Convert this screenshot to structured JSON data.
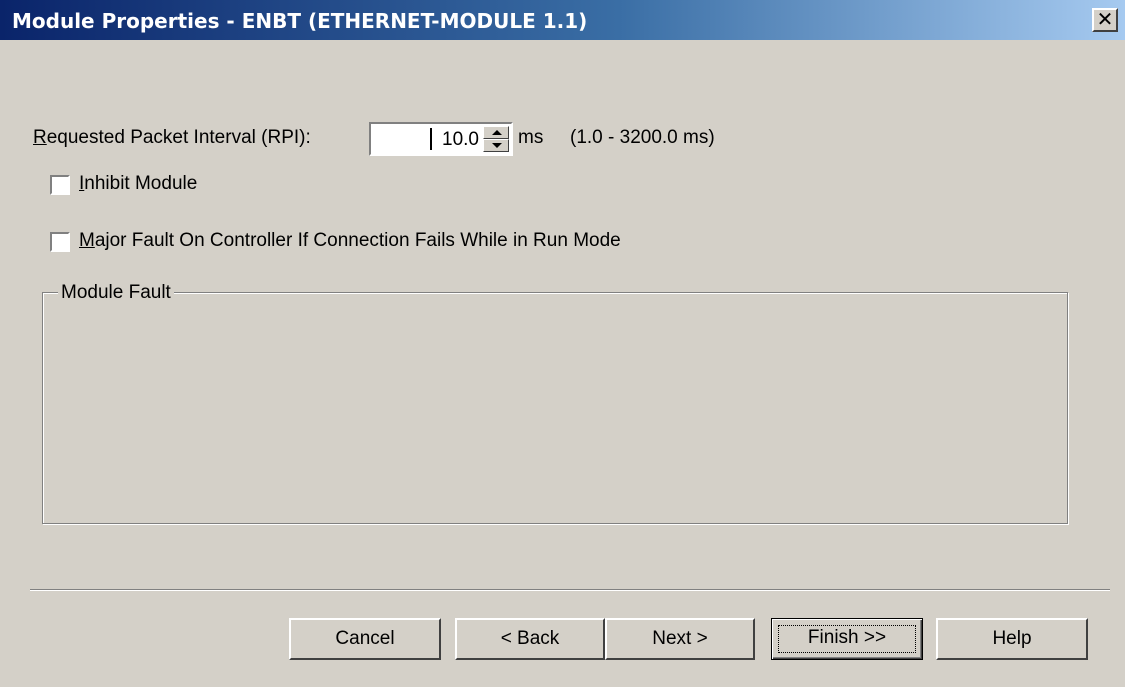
{
  "window": {
    "title": "Module Properties - ENBT (ETHERNET-MODULE 1.1)",
    "close_symbol": "✕"
  },
  "rpi": {
    "label_accel": "R",
    "label_rest": "equested Packet Interval (RPI):",
    "value": "10.0",
    "unit": "ms",
    "range": "(1.0 - 3200.0 ms)"
  },
  "inhibit": {
    "label_accel": "I",
    "label_rest": "nhibit Module",
    "checked": false
  },
  "major_fault": {
    "label_accel": "M",
    "label_rest": "ajor Fault On Controller If Connection Fails While in Run Mode",
    "checked": false
  },
  "module_fault": {
    "legend": "Module Fault"
  },
  "buttons": {
    "cancel": "Cancel",
    "back": "< Back",
    "next": "Next >",
    "finish": "Finish >>",
    "help": "Help"
  },
  "icons": {
    "close": "close-icon",
    "spin_up": "chevron-up-icon",
    "spin_down": "chevron-down-icon"
  }
}
